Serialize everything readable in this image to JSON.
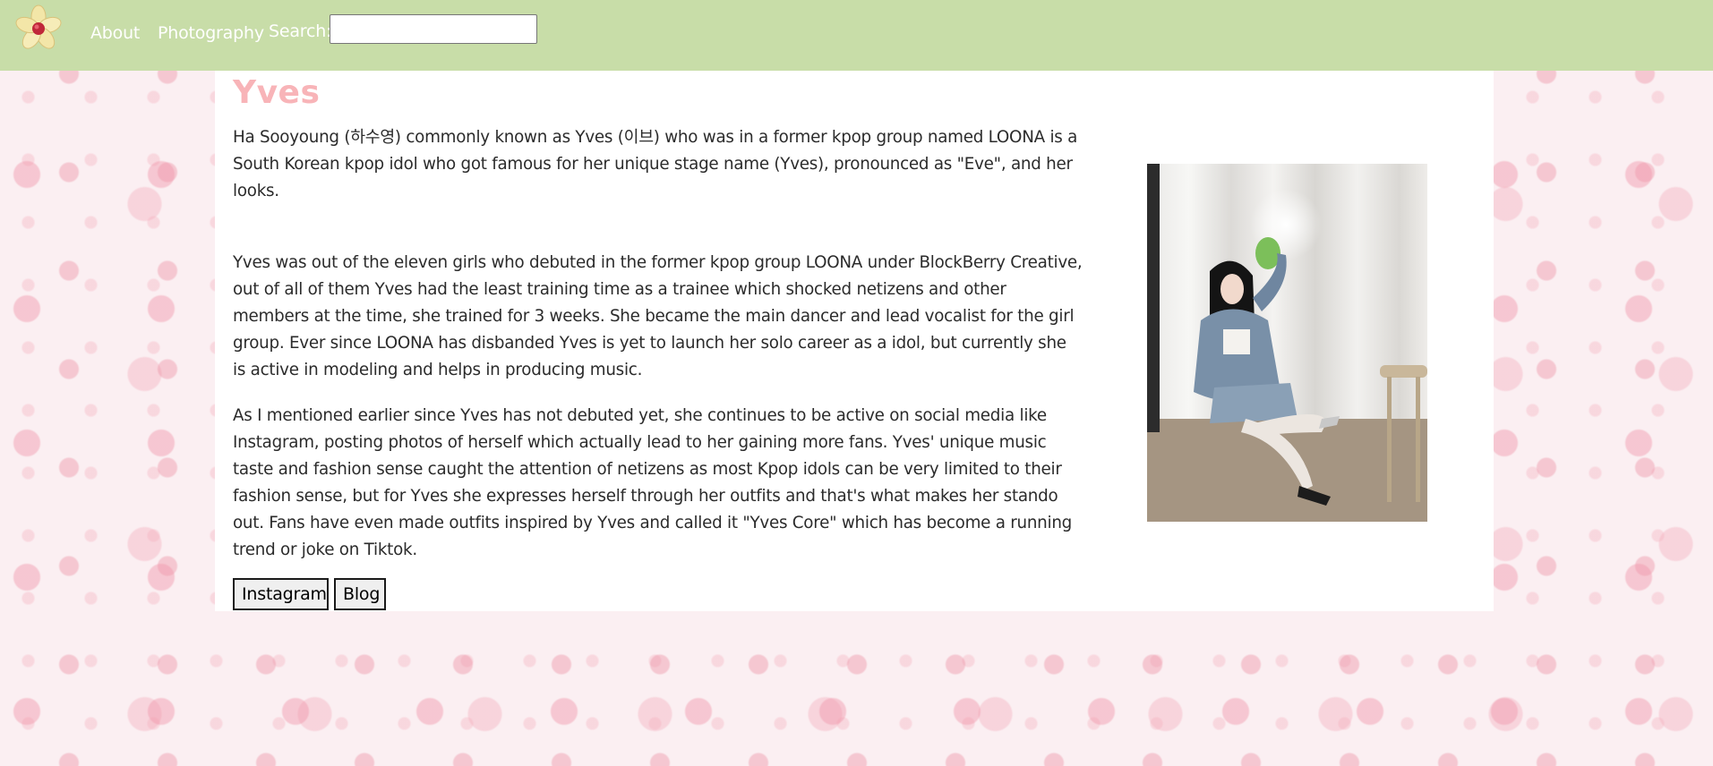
{
  "nav": {
    "logo_icon": "flower-logo-icon",
    "about_label": "About",
    "photography_label": "Photography",
    "search_label": "Search:",
    "search_value": ""
  },
  "main": {
    "title": "Yves",
    "paragraphs": [
      "Ha Sooyoung (하수영) commonly known as Yves (이브) who was in a former kpop group named LOONA is a South Korean kpop idol who got famous for her unique stage name (Yves), pronounced as \"Eve\", and her looks.",
      "Yves was out of the eleven girls who debuted in the former kpop group LOONA under BlockBerry Creative, out of all of them Yves had the least training time as a trainee which shocked netizens and other members at the time, she trained for 3 weeks. She became the main dancer and lead vocalist for the girl group. Ever since LOONA has disbanded Yves is yet to launch her solo career as a idol, but currently she is active in modeling and helps in producing music.",
      "As I mentioned earlier since Yves has not debuted yet, she continues to be active on social media like Instagram, posting photos of herself which actually lead to her gaining more fans. Yves' unique music taste and fashion sense caught the attention of netizens as most Kpop idols can be very limited to their fashion sense, but for Yves she expresses herself through her outfits and that's what makes her stando out. Fans have even made outfits inspired by Yves and called it \"Yves Core\" which has become a running trend or joke on Tiktok."
    ],
    "buttons": {
      "instagram_label": "Instagram",
      "blog_label": "Blog"
    }
  },
  "colors": {
    "navbar_bg": "#c8dda8",
    "title": "#f8b4b8",
    "page_bg": "#fbeff2"
  }
}
